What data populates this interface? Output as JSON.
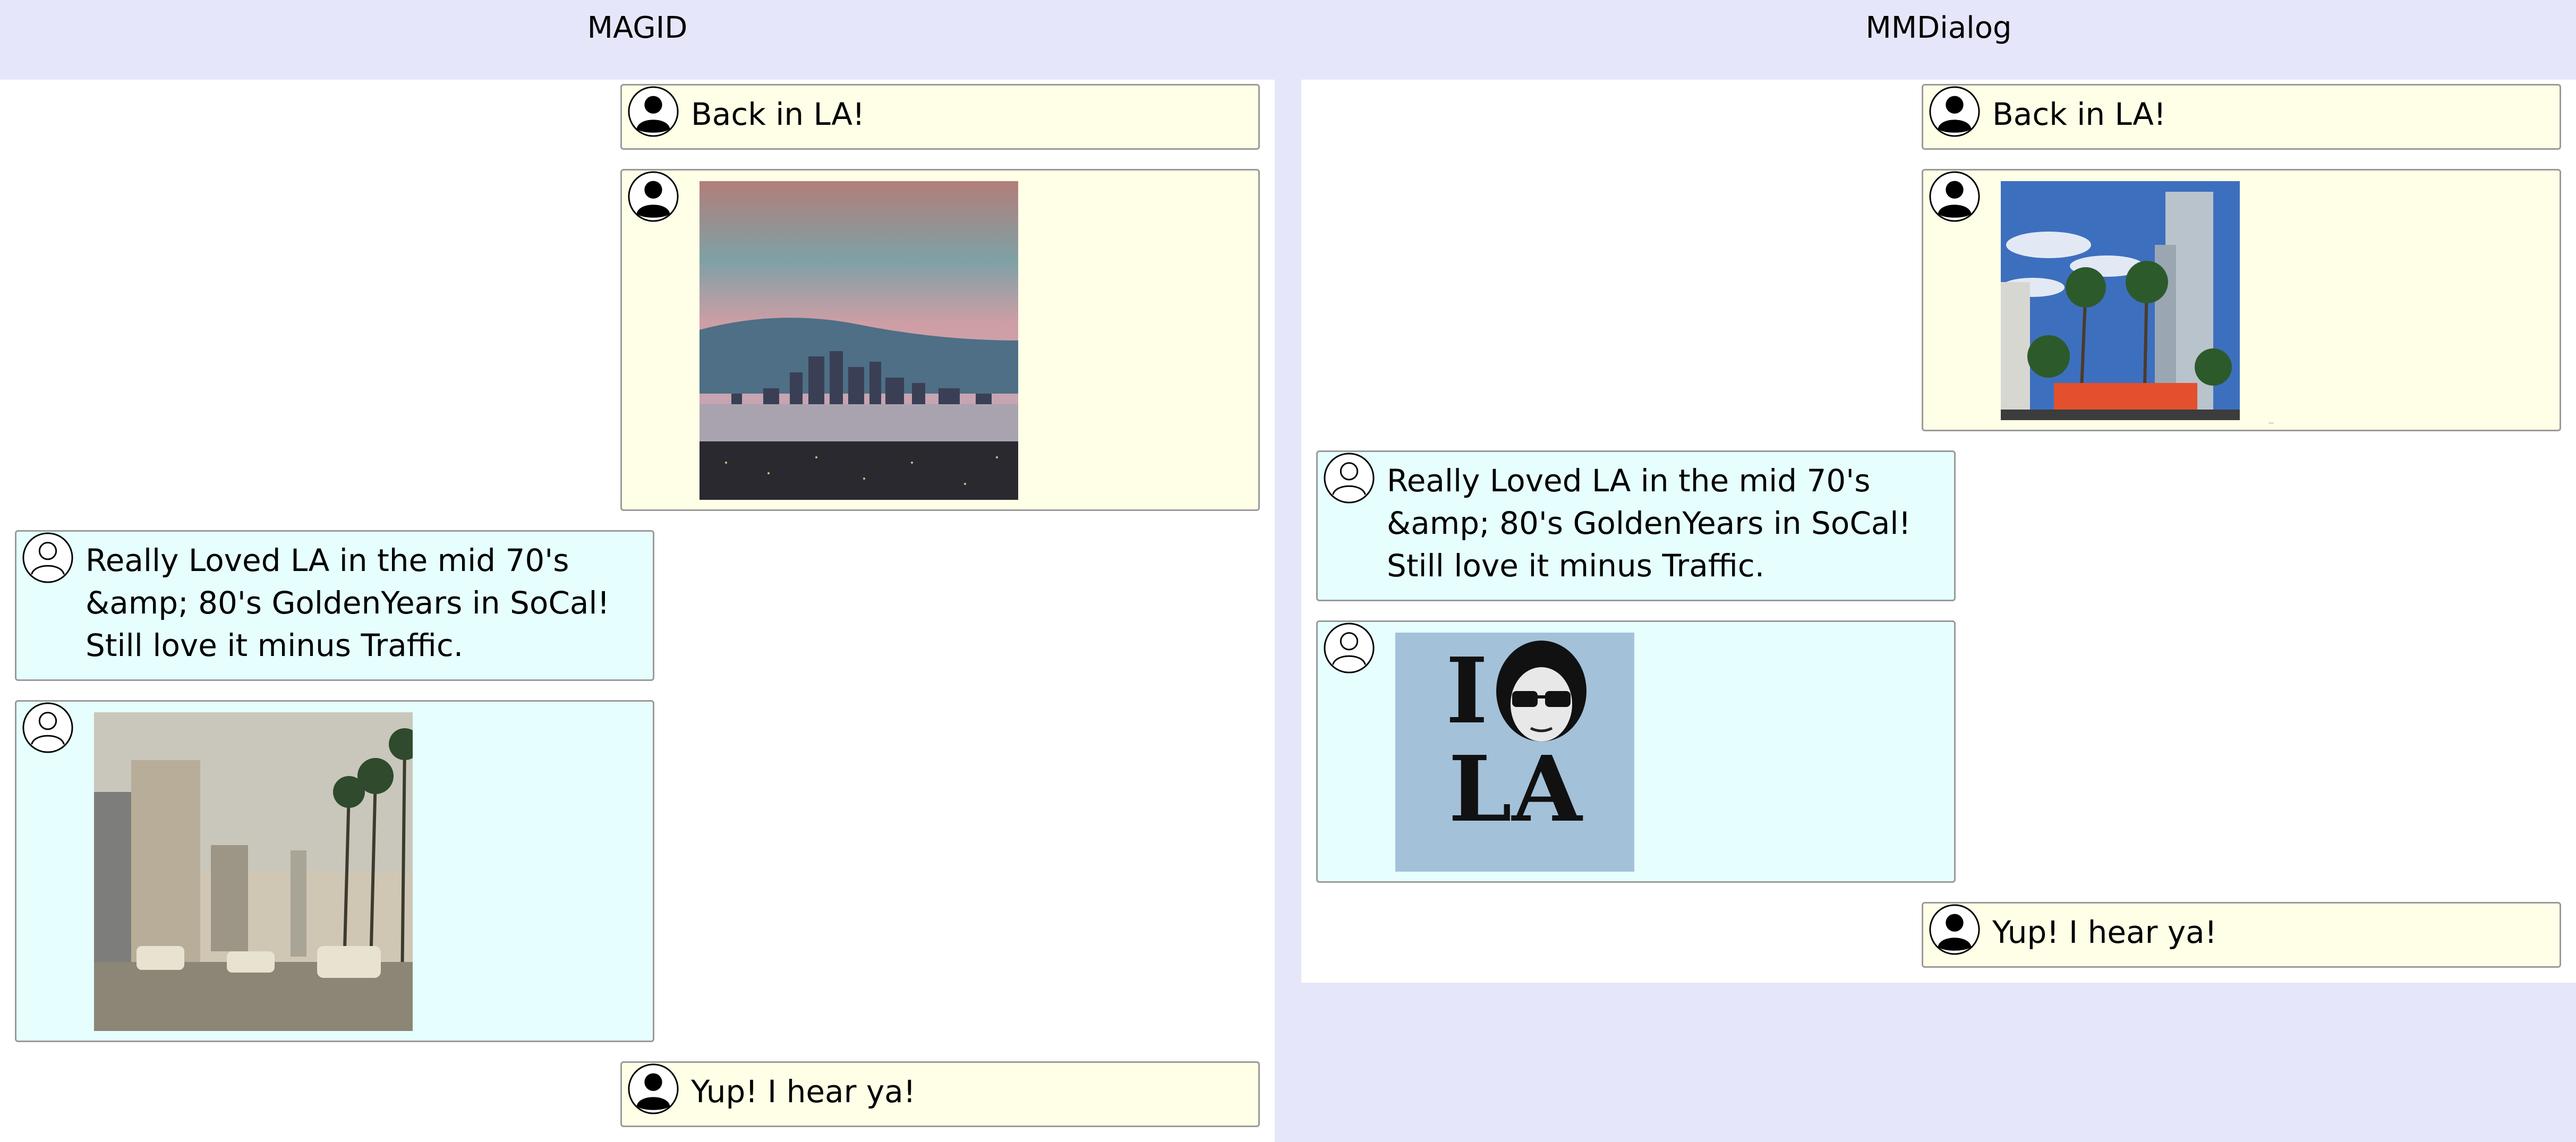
{
  "columns": [
    {
      "title": "MAGID"
    },
    {
      "title": "MMDialog"
    }
  ],
  "magid": {
    "messages": [
      {
        "speaker": "user1",
        "text": "Back in LA!"
      },
      {
        "speaker": "user1",
        "image": "la-skyline-photo"
      },
      {
        "speaker": "user2",
        "text": "Really Loved LA in the mid 70's &amp; 80's GoldenYears in SoCal! Still love it minus Traffic."
      },
      {
        "speaker": "user2",
        "image": "vintage-la-street-photo"
      },
      {
        "speaker": "user1",
        "text": "Yup! I hear ya!"
      }
    ]
  },
  "mmdialog": {
    "messages": [
      {
        "speaker": "user1",
        "text": "Back in LA!"
      },
      {
        "speaker": "user1",
        "image": "la-downtown-palms-photo"
      },
      {
        "speaker": "user2",
        "text": "Really Loved LA in the mid 70's &amp; 80's GoldenYears in SoCal! Still love it minus Traffic."
      },
      {
        "speaker": "user2",
        "image": "i-love-la-graphic",
        "image_text": {
          "line1": "I",
          "line2": "LA"
        }
      },
      {
        "speaker": "user1",
        "text": "Yup! I hear ya!"
      }
    ]
  },
  "colors": {
    "background": "#e6e6fa",
    "panel": "#ffffff",
    "user1_bubble": "#fffee6",
    "user2_bubble": "#e6fefe",
    "bubble_border": "#9a9a9a"
  },
  "icons": {
    "user1_avatar": "filled-person-icon",
    "user2_avatar": "outline-person-icon"
  }
}
